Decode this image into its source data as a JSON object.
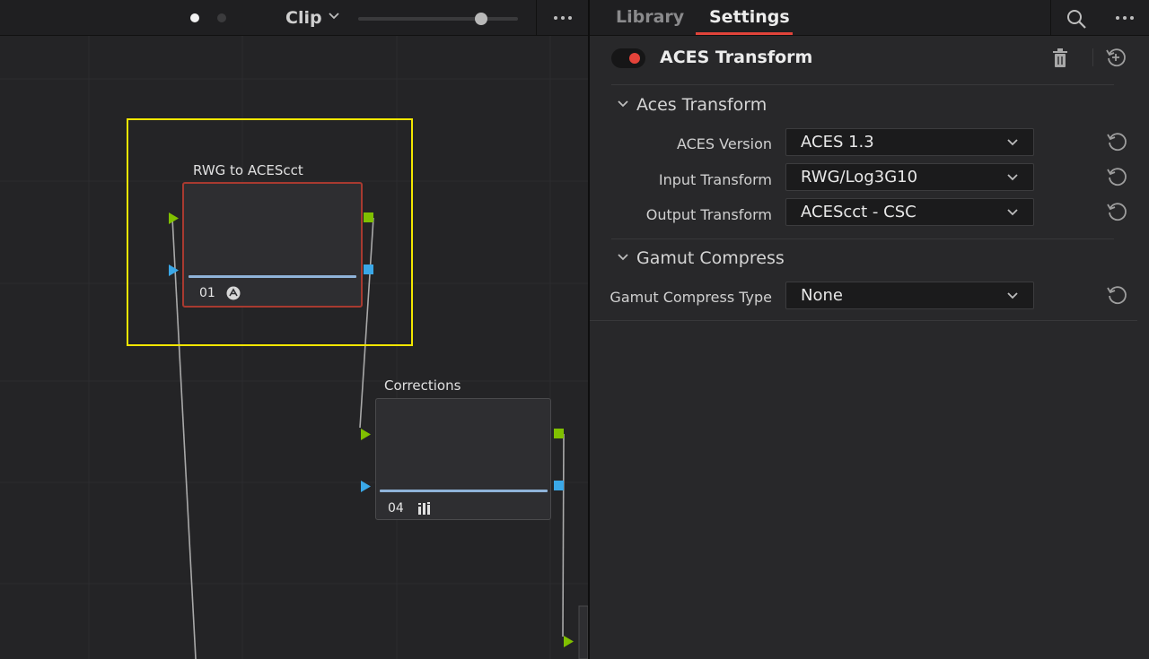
{
  "toolbar": {
    "clip_label": "Clip",
    "zoom_level": 0.77
  },
  "nodes": [
    {
      "label": "RWG to ACEScct",
      "number": "01",
      "badge_icon": "aces-logo-icon",
      "selected": true
    },
    {
      "label": "Corrections",
      "number": "04",
      "badge_icon": "bars-icon",
      "selected": false
    }
  ],
  "panel": {
    "tabs": [
      "Library",
      "Settings"
    ],
    "active_tab": "Settings",
    "effect": {
      "title": "ACES Transform",
      "enabled": true,
      "toggle_color": "#e5433a"
    },
    "sections": [
      {
        "title": "Aces Transform",
        "properties": [
          {
            "label": "ACES Version",
            "value": "ACES 1.3"
          },
          {
            "label": "Input Transform",
            "value": "RWG/Log3G10"
          },
          {
            "label": "Output Transform",
            "value": "ACEScct - CSC"
          }
        ]
      },
      {
        "title": "Gamut Compress",
        "properties": [
          {
            "label": "Gamut Compress Type",
            "value": "None"
          }
        ]
      }
    ]
  },
  "colors": {
    "selection": "#f2e600",
    "input_rgb": "#80c000",
    "input_key": "#3aa8e8",
    "accent": "#e0433a"
  }
}
